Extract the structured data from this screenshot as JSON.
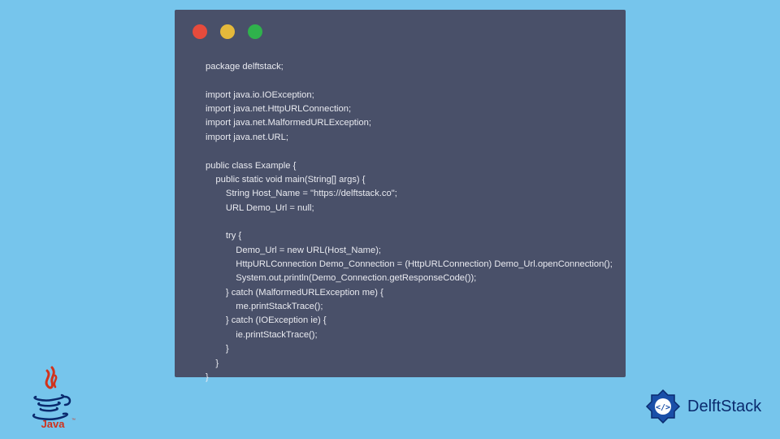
{
  "window": {
    "dots": [
      "red",
      "yellow",
      "green"
    ]
  },
  "code": {
    "line1": "package delftstack;",
    "line2": "",
    "line3": "import java.io.IOException;",
    "line4": "import java.net.HttpURLConnection;",
    "line5": "import java.net.MalformedURLException;",
    "line6": "import java.net.URL;",
    "line7": "",
    "line8": "public class Example {",
    "line9": "    public static void main(String[] args) {",
    "line10": "        String Host_Name = \"https://delftstack.co\";",
    "line11": "        URL Demo_Url = null;",
    "line12": "",
    "line13": "        try {",
    "line14": "            Demo_Url = new URL(Host_Name);",
    "line15": "            HttpURLConnection Demo_Connection = (HttpURLConnection) Demo_Url.openConnection();",
    "line16": "            System.out.println(Demo_Connection.getResponseCode());",
    "line17": "        } catch (MalformedURLException me) {",
    "line18": "            me.printStackTrace();",
    "line19": "        } catch (IOException ie) {",
    "line20": "            ie.printStackTrace();",
    "line21": "        }",
    "line22": "    }",
    "line23": "}"
  },
  "branding": {
    "java_label": "Java",
    "delftstack_label": "DelftStack"
  },
  "colors": {
    "background": "#76c5ec",
    "window": "#495069",
    "dot_red": "#e64b3c",
    "dot_yellow": "#e5b93b",
    "dot_green": "#2fb24c",
    "code_text": "#e9eaf0",
    "brand_navy": "#0a2a6e",
    "java_red": "#d1321c"
  }
}
